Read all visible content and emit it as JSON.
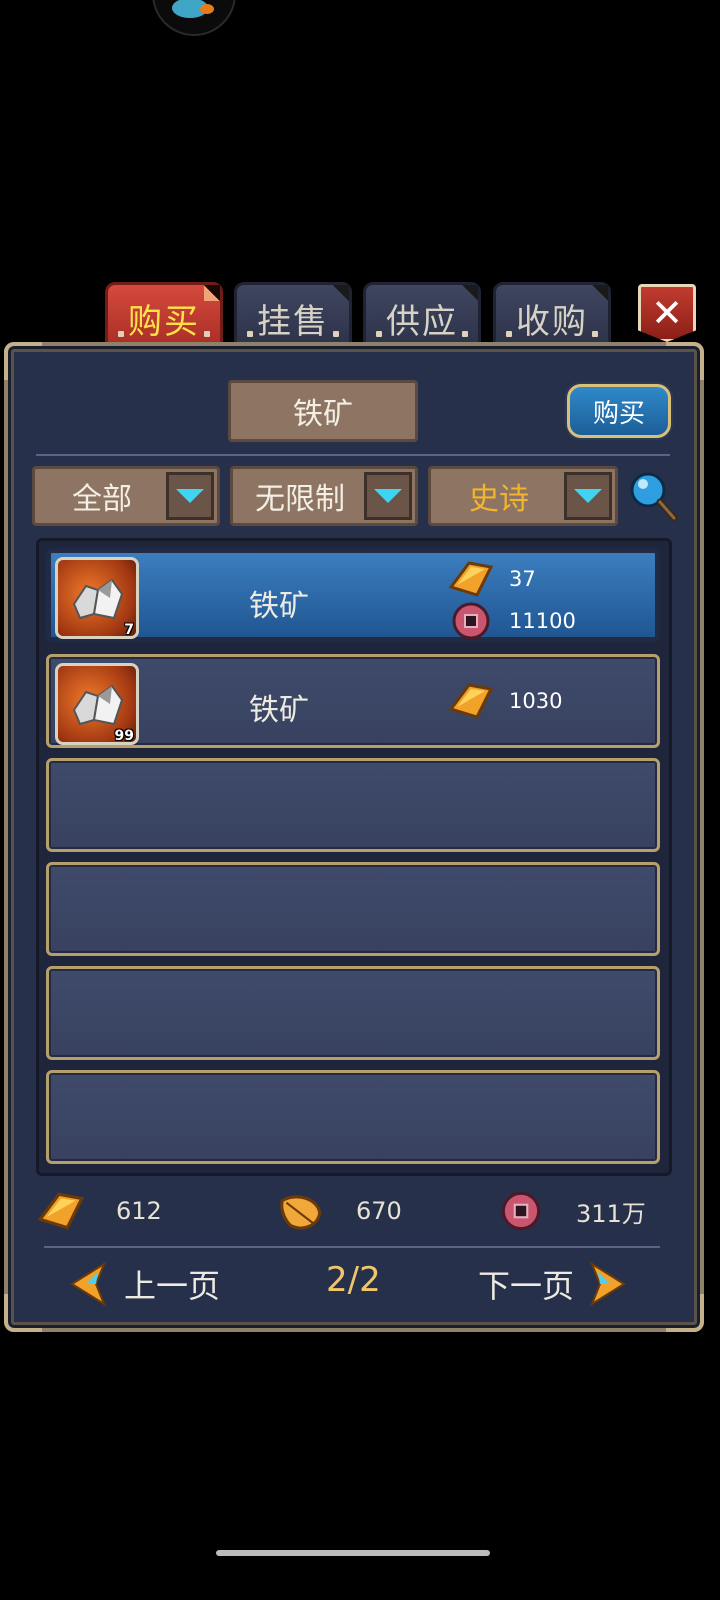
{
  "tabs": [
    {
      "label": "购买",
      "active": true
    },
    {
      "label": "挂售",
      "active": false
    },
    {
      "label": "供应",
      "active": false
    },
    {
      "label": "收购",
      "active": false
    }
  ],
  "close_label": "✕",
  "header": {
    "item_title": "铁矿",
    "buy_button": "购买"
  },
  "filters": [
    {
      "label": "全部"
    },
    {
      "label": "无限制"
    },
    {
      "label": "史诗",
      "color": "#f3b52c"
    }
  ],
  "listings": [
    {
      "name": "铁矿",
      "quantity": "7",
      "gold_price": "37",
      "coin_price": "11100",
      "selected": true
    },
    {
      "name": "铁矿",
      "quantity": "99",
      "gold_price": "1030",
      "selected": false
    }
  ],
  "empty_rows": 4,
  "balances": {
    "gold": "612",
    "leaf": "670",
    "coins": "311万"
  },
  "pagination": {
    "prev_label": "上一页",
    "next_label": "下一页",
    "current": "2/2"
  },
  "colors": {
    "accent_gold": "#f0c66a",
    "epic": "#f3b52c",
    "tab_active": "#d54a3c",
    "selected_row": "#3c7fc0"
  }
}
